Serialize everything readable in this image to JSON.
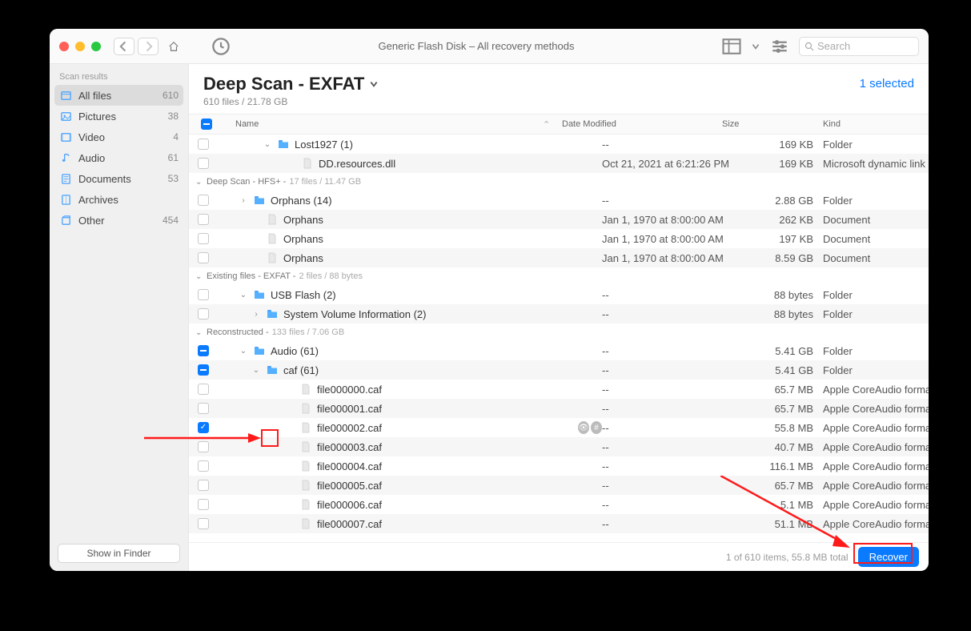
{
  "toolbar": {
    "title": "Generic Flash Disk – All recovery methods",
    "search_placeholder": "Search"
  },
  "sidebar": {
    "header": "Scan results",
    "items": [
      {
        "icon": "allfiles",
        "label": "All files",
        "count": "610",
        "active": true,
        "color": "#4aa3ff"
      },
      {
        "icon": "pictures",
        "label": "Pictures",
        "count": "38",
        "color": "#4aa3ff"
      },
      {
        "icon": "video",
        "label": "Video",
        "count": "4",
        "color": "#4aa3ff"
      },
      {
        "icon": "audio",
        "label": "Audio",
        "count": "61",
        "color": "#4aa3ff"
      },
      {
        "icon": "documents",
        "label": "Documents",
        "count": "53",
        "color": "#4aa3ff"
      },
      {
        "icon": "archives",
        "label": "Archives",
        "count": "",
        "color": "#4aa3ff"
      },
      {
        "icon": "other",
        "label": "Other",
        "count": "454",
        "color": "#4aa3ff"
      }
    ],
    "footer_button": "Show in Finder"
  },
  "main": {
    "title": "Deep Scan - EXFAT",
    "subtitle": "610 files / 21.78 GB",
    "selected_text": "1 selected",
    "columns": {
      "name": "Name",
      "date": "Date Modified",
      "size": "Size",
      "kind": "Kind"
    }
  },
  "rows": [
    {
      "type": "row",
      "alt": false,
      "chk": "empty",
      "indent": 50,
      "disclose": "down",
      "icon": "folder",
      "name": "Lost1927 (1)",
      "date": "--",
      "size": "169 KB",
      "kind": "Folder"
    },
    {
      "type": "row",
      "alt": true,
      "chk": "empty",
      "indent": 80,
      "disclose": "",
      "icon": "file",
      "name": "DD.resources.dll",
      "date": "Oct 21, 2021 at 6:21:26 PM",
      "size": "169 KB",
      "kind": "Microsoft dynamic link"
    },
    {
      "type": "group",
      "label": "Deep Scan - HFS+ -",
      "meta": "17 files / 11.47 GB"
    },
    {
      "type": "row",
      "alt": false,
      "chk": "empty",
      "indent": 20,
      "disclose": "right",
      "icon": "folder",
      "name": "Orphans (14)",
      "date": "--",
      "size": "2.88 GB",
      "kind": "Folder"
    },
    {
      "type": "row",
      "alt": true,
      "chk": "empty",
      "indent": 36,
      "disclose": "",
      "icon": "file",
      "name": "Orphans",
      "date": "Jan 1, 1970 at 8:00:00 AM",
      "size": "262 KB",
      "kind": "Document"
    },
    {
      "type": "row",
      "alt": false,
      "chk": "empty",
      "indent": 36,
      "disclose": "",
      "icon": "file",
      "name": "Orphans",
      "date": "Jan 1, 1970 at 8:00:00 AM",
      "size": "197 KB",
      "kind": "Document"
    },
    {
      "type": "row",
      "alt": true,
      "chk": "empty",
      "indent": 36,
      "disclose": "",
      "icon": "file",
      "name": "Orphans",
      "date": "Jan 1, 1970 at 8:00:00 AM",
      "size": "8.59 GB",
      "kind": "Document"
    },
    {
      "type": "group",
      "label": "Existing files - EXFAT -",
      "meta": "2 files / 88 bytes"
    },
    {
      "type": "row",
      "alt": false,
      "chk": "empty",
      "indent": 20,
      "disclose": "down",
      "icon": "folder",
      "name": "USB Flash (2)",
      "date": "--",
      "size": "88 bytes",
      "kind": "Folder"
    },
    {
      "type": "row",
      "alt": true,
      "chk": "empty",
      "indent": 36,
      "disclose": "right",
      "icon": "folder",
      "name": "System Volume Information (2)",
      "date": "--",
      "size": "88 bytes",
      "kind": "Folder"
    },
    {
      "type": "group",
      "label": "Reconstructed -",
      "meta": "133 files / 7.06 GB"
    },
    {
      "type": "row",
      "alt": false,
      "chk": "mixed",
      "indent": 20,
      "disclose": "down",
      "icon": "folder",
      "name": "Audio (61)",
      "date": "--",
      "size": "5.41 GB",
      "kind": "Folder"
    },
    {
      "type": "row",
      "alt": true,
      "chk": "mixed",
      "indent": 36,
      "disclose": "down",
      "icon": "folder",
      "name": "caf (61)",
      "date": "--",
      "size": "5.41 GB",
      "kind": "Folder"
    },
    {
      "type": "row",
      "alt": false,
      "chk": "empty",
      "indent": 78,
      "disclose": "",
      "icon": "file",
      "name": "file000000.caf",
      "date": "--",
      "size": "65.7 MB",
      "kind": "Apple CoreAudio forma"
    },
    {
      "type": "row",
      "alt": true,
      "chk": "empty",
      "indent": 78,
      "disclose": "",
      "icon": "file",
      "name": "file000001.caf",
      "date": "--",
      "size": "65.7 MB",
      "kind": "Apple CoreAudio forma"
    },
    {
      "type": "row",
      "alt": false,
      "chk": "checked",
      "indent": 78,
      "disclose": "",
      "icon": "file",
      "name": "file000002.caf",
      "date": "--",
      "size": "55.8 MB",
      "kind": "Apple CoreAudio forma",
      "eye": true,
      "highlight": true
    },
    {
      "type": "row",
      "alt": true,
      "chk": "empty",
      "indent": 78,
      "disclose": "",
      "icon": "file",
      "name": "file000003.caf",
      "date": "--",
      "size": "40.7 MB",
      "kind": "Apple CoreAudio forma"
    },
    {
      "type": "row",
      "alt": false,
      "chk": "empty",
      "indent": 78,
      "disclose": "",
      "icon": "file",
      "name": "file000004.caf",
      "date": "--",
      "size": "116.1 MB",
      "kind": "Apple CoreAudio forma"
    },
    {
      "type": "row",
      "alt": true,
      "chk": "empty",
      "indent": 78,
      "disclose": "",
      "icon": "file",
      "name": "file000005.caf",
      "date": "--",
      "size": "65.7 MB",
      "kind": "Apple CoreAudio forma"
    },
    {
      "type": "row",
      "alt": false,
      "chk": "empty",
      "indent": 78,
      "disclose": "",
      "icon": "file",
      "name": "file000006.caf",
      "date": "--",
      "size": "5.1 MB",
      "kind": "Apple CoreAudio forma"
    },
    {
      "type": "row",
      "alt": true,
      "chk": "empty",
      "indent": 78,
      "disclose": "",
      "icon": "file",
      "name": "file000007.caf",
      "date": "--",
      "size": "51.1 MB",
      "kind": "Apple CoreAudio forma"
    }
  ],
  "footer": {
    "status": "1 of 610 items, 55.8 MB total",
    "recover": "Recover"
  }
}
